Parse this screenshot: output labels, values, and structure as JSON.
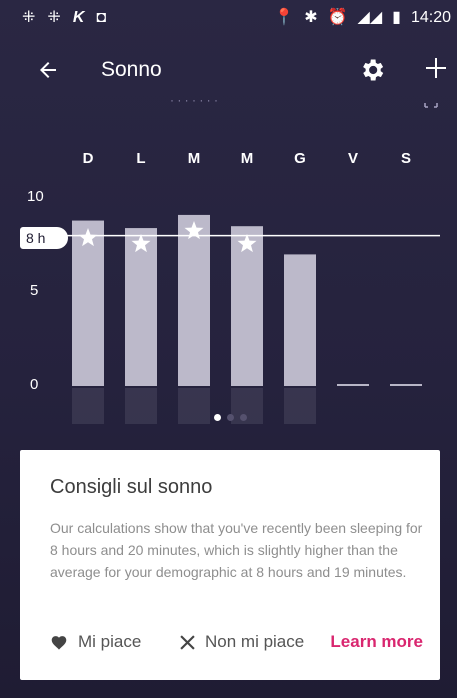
{
  "status_bar": {
    "left_icons": [
      "app-icon",
      "app-icon",
      "s-app-icon",
      "camera-icon"
    ],
    "right_icons": [
      "location-icon",
      "bluetooth-icon",
      "alarm-icon",
      "signal-icon",
      "battery-icon"
    ],
    "time": "14:20"
  },
  "app_bar": {
    "title": "Sonno",
    "back_icon": "arrow-left-icon",
    "settings_icon": "gear-icon",
    "add_icon": "plus-icon"
  },
  "chart_data": {
    "type": "bar",
    "categories": [
      "D",
      "L",
      "M",
      "M",
      "G",
      "V",
      "S"
    ],
    "values": [
      8.8,
      8.4,
      9.1,
      8.5,
      7.0,
      0,
      0
    ],
    "goal_met": [
      true,
      true,
      true,
      true,
      false,
      false,
      false
    ],
    "ylim": [
      0,
      10
    ],
    "yticks": [
      "10",
      "5",
      "0"
    ],
    "goal_line": 8,
    "goal_label": "8 h",
    "colors": {
      "bar": "#c9c7d6",
      "line": "#ffffff"
    }
  },
  "pager": {
    "pages": 3,
    "active": 0
  },
  "card": {
    "title": "Consigli sul sonno",
    "body": "Our calculations show that you've recently been sleeping for 8 hours and 20 minutes, which is slightly higher than the average for your demographic at 8 hours and 19 minutes.",
    "like_label": "Mi piace",
    "dislike_label": "Non mi piace",
    "learn_more_label": "Learn more",
    "accent": "#d9266f"
  }
}
